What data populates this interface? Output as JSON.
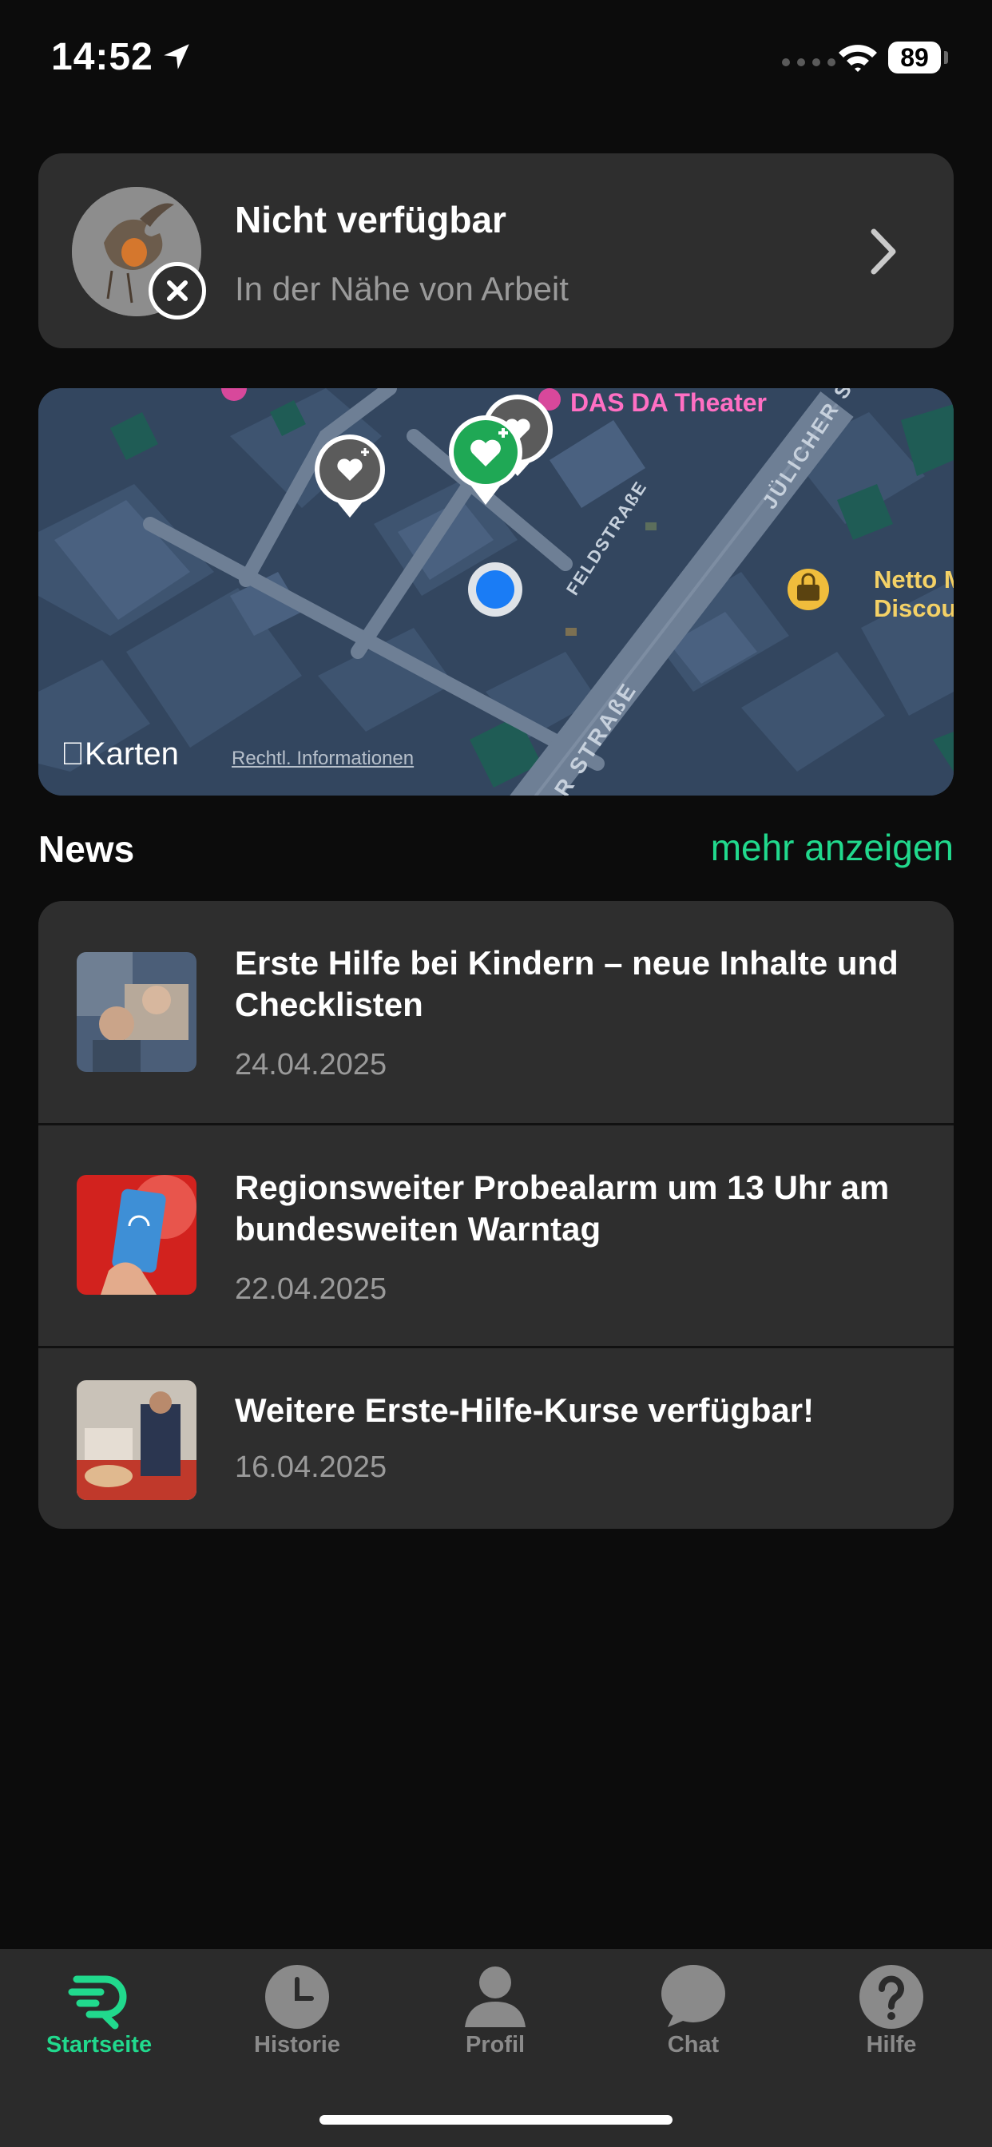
{
  "status_bar": {
    "time": "14:52",
    "battery": "89"
  },
  "availability": {
    "title": "Nicht verfügbar",
    "subtitle": "In der Nähe von Arbeit"
  },
  "map": {
    "poi_theater": "DAS DA Theater",
    "poi_netto_line1": "Netto Ma",
    "poi_netto_line2": "Discount",
    "street_feld": "FELDSTRAßE",
    "street_juelicher": "JÜLICHER S",
    "street_partial": "R STRAßE",
    "brand": "Karten",
    "legal": "Rechtl. Informationen"
  },
  "news": {
    "heading": "News",
    "more": "mehr anzeigen",
    "items": [
      {
        "title": "Erste Hilfe bei Kindern – neue Inhalte und Checklisten",
        "date": "24.04.2025"
      },
      {
        "title": "Regionsweiter Probealarm um 13 Uhr am bundesweiten Warntag",
        "date": "22.04.2025"
      },
      {
        "title": "Weitere Erste-Hilfe-Kurse verfügbar!",
        "date": "16.04.2025"
      }
    ]
  },
  "tabs": [
    {
      "label": "Startseite",
      "icon": "app-logo-icon",
      "active": true
    },
    {
      "label": "Historie",
      "icon": "clock-icon",
      "active": false
    },
    {
      "label": "Profil",
      "icon": "person-icon",
      "active": false
    },
    {
      "label": "Chat",
      "icon": "chat-bubble-icon",
      "active": false
    },
    {
      "label": "Hilfe",
      "icon": "question-icon",
      "active": false
    }
  ],
  "colors": {
    "accent": "#21d98d",
    "card": "#2e2e2e",
    "background": "#0c0c0c"
  }
}
